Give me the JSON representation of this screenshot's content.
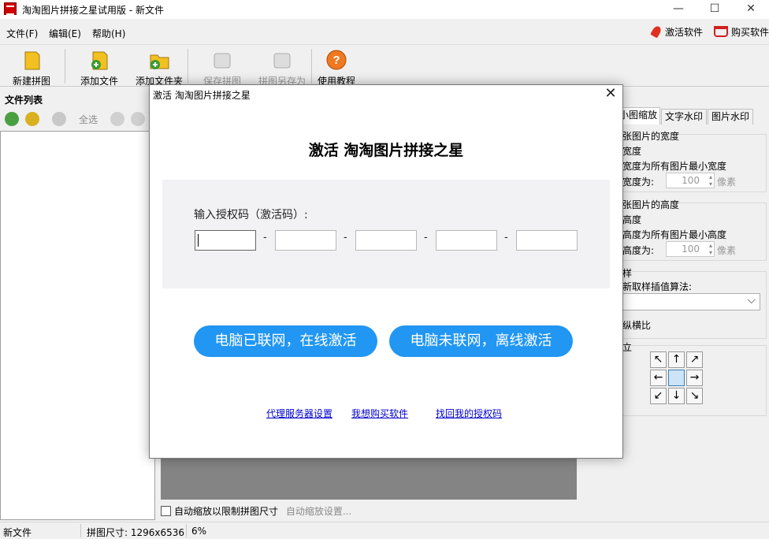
{
  "window": {
    "title": "淘淘图片拼接之星试用版 - 新文件"
  },
  "menu": {
    "items": [
      "文件(F)",
      "编辑(E)",
      "帮助(H)"
    ],
    "activate": "激活软件",
    "buy": "购买软件"
  },
  "toolbar": {
    "items": [
      "新建拼图",
      "添加文件",
      "添加文件夹",
      "保存拼图",
      "拼图另存为",
      "使用教程"
    ]
  },
  "filelist": {
    "title": "文件列表",
    "select_all": "全选"
  },
  "right_tabs": [
    "小图缩放",
    "文字水印",
    "图片水印"
  ],
  "right_panel": {
    "width_group": "张图片的宽度",
    "width_opt1": "宽度",
    "width_opt2": "宽度为所有图片最小宽度",
    "width_opt3": "宽度为:",
    "width_value": "100",
    "width_unit": "像素",
    "height_group": "张图片的高度",
    "height_opt1": "高度",
    "height_opt2": "高度为所有图片最小高度",
    "height_opt3": "高度为:",
    "height_value": "100",
    "height_unit": "像素",
    "algo_group": "样",
    "algo_label": "新取样插值算法:",
    "ratio": "纵横比",
    "align_group": "立",
    "arrows": [
      "↖",
      "↑",
      "↗",
      "←",
      "",
      "→",
      "↙",
      "↓",
      "↘"
    ]
  },
  "bottom": {
    "auto_scale": "自动缩放以限制拼图尺寸",
    "auto_scale_settings": "自动缩放设置..."
  },
  "status": {
    "file": "新文件",
    "size": "拼图尺寸: 1296x6536",
    "zoom": "6%"
  },
  "dialog": {
    "title": "激活 淘淘图片拼接之星",
    "heading": "激活 淘淘图片拼接之星",
    "code_label": "输入授权码（激活码）:",
    "dash": "-",
    "online_btn": "电脑已联网，在线激活",
    "offline_btn": "电脑未联网，离线激活",
    "links": [
      "代理服务器设置",
      "我想购买软件",
      "找回我的授权码"
    ]
  },
  "colors": {
    "accent": "#2196f3",
    "link": "#0000cc"
  }
}
